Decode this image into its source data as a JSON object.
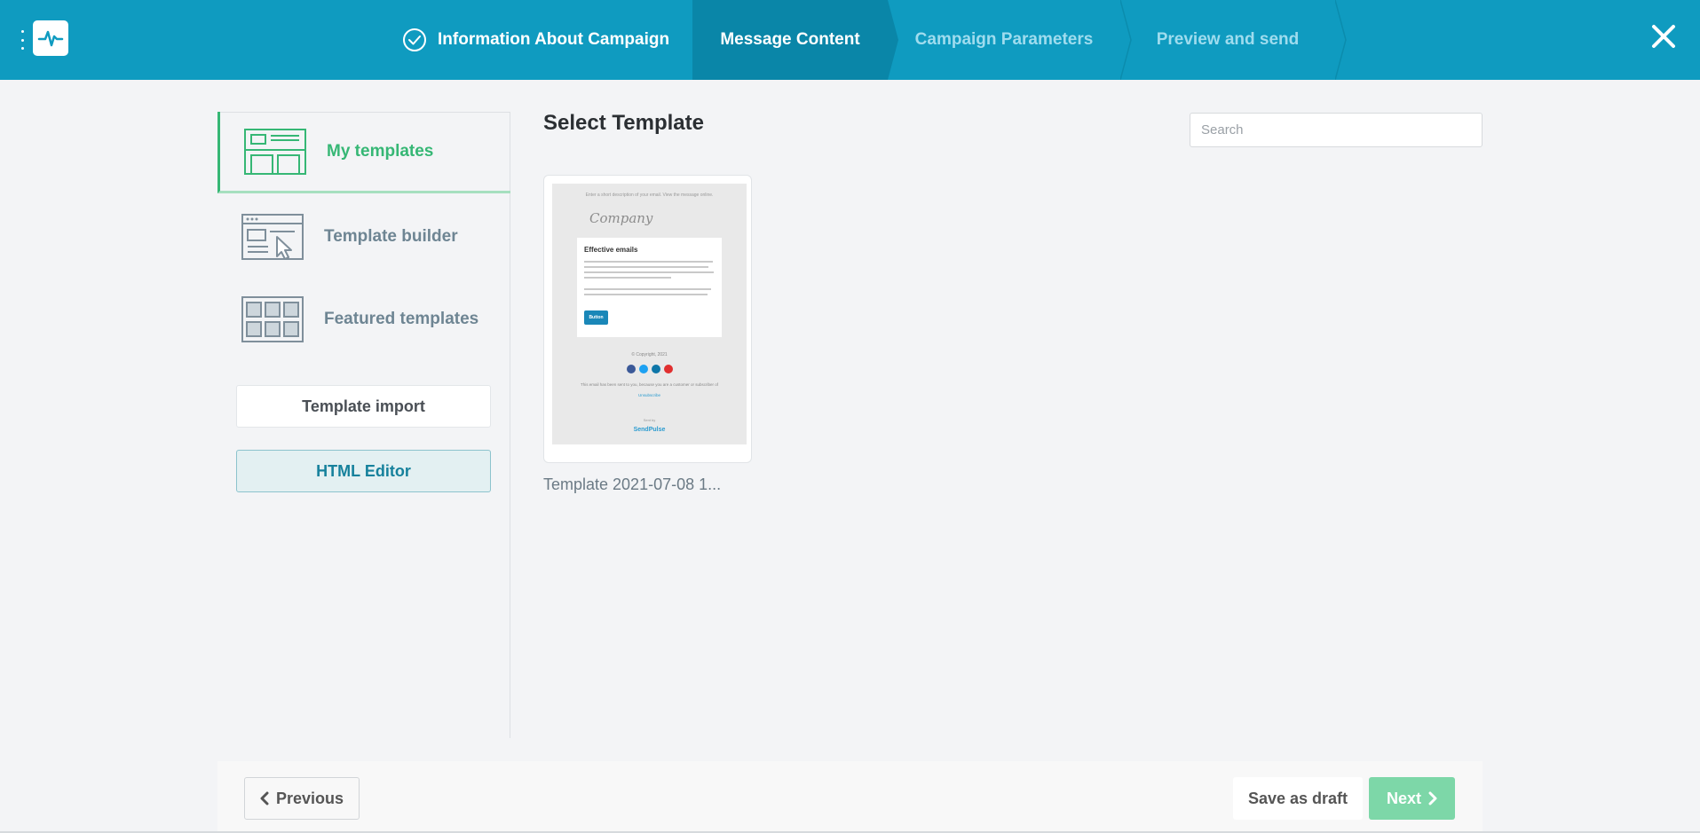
{
  "header": {
    "steps": [
      {
        "label": "Information About Campaign",
        "state": "done"
      },
      {
        "label": "Message Content",
        "state": "active"
      },
      {
        "label": "Campaign Parameters",
        "state": "upcoming"
      },
      {
        "label": "Preview and send",
        "state": "upcoming"
      }
    ],
    "colors": {
      "bar": "#0f9bc0",
      "active_step": "#0a86a8",
      "upcoming_text": "#9fdcee"
    }
  },
  "sidebar": {
    "items": [
      {
        "label": "My templates",
        "icon": "my-templates-icon",
        "active": true
      },
      {
        "label": "Template builder",
        "icon": "template-builder-icon",
        "active": false
      },
      {
        "label": "Featured templates",
        "icon": "featured-templates-icon",
        "active": false
      }
    ],
    "import_label": "Template import",
    "html_editor_label": "HTML Editor",
    "colors": {
      "active": "#36b775",
      "inactive": "#6e8593"
    }
  },
  "main": {
    "title": "Select Template",
    "search": {
      "placeholder": "Search",
      "value": ""
    },
    "templates": [
      {
        "name": "Template 2021-07-08 1...",
        "preview": {
          "top_text": "Enter a short description of your email. View the message online.",
          "company": "Company",
          "heading": "Effective emails",
          "button": "Button",
          "copyright": "© Copyright, 2021",
          "note": "This email has been sent to you, because you are a customer or subscriber of",
          "unsubscribe": "Unsubscribe",
          "sent_by": "Sent by",
          "brand": "SendPulse"
        }
      }
    ]
  },
  "footer": {
    "previous_label": "Previous",
    "save_draft_label": "Save as draft",
    "next_label": "Next",
    "colors": {
      "next": "#7dd7a8"
    }
  }
}
